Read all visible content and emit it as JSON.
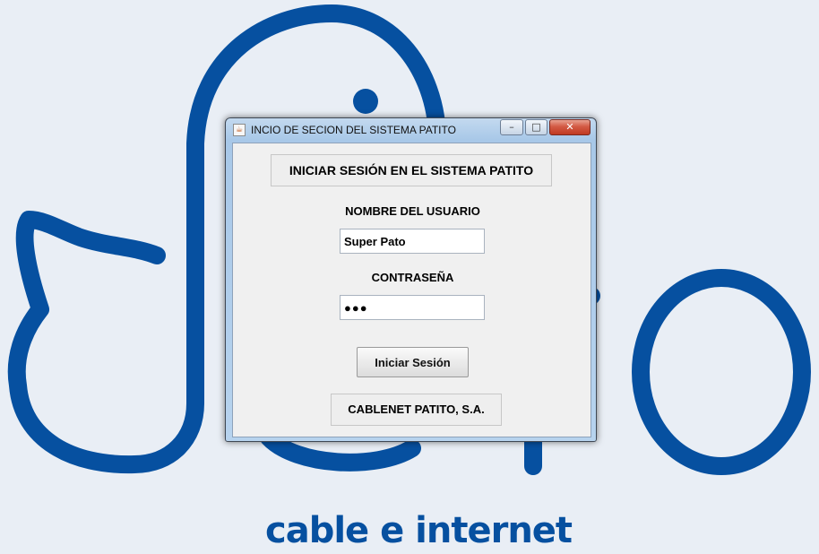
{
  "background": {
    "brand_color": "#0650a0",
    "tagline": "cable e internet"
  },
  "window": {
    "title": "INCIO DE SECION DEL SISTEMA PATITO",
    "icon": "java-cup-icon",
    "controls": {
      "minimize": "–",
      "maximize": "□",
      "close": "✕"
    }
  },
  "form": {
    "heading": "INICIAR SESIÓN EN EL SISTEMA PATITO",
    "username_label": "NOMBRE DEL USUARIO",
    "username_value": "Super Pato",
    "password_label": "CONTRASEÑA",
    "password_value": "●●●",
    "submit_label": "Iniciar Sesión",
    "company": "CABLENET PATITO, S.A."
  }
}
